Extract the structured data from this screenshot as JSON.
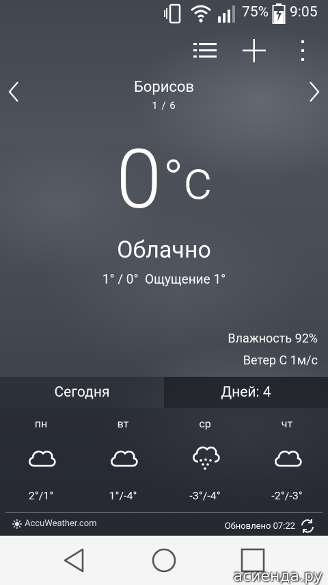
{
  "status_bar": {
    "battery_percent": "75%",
    "time": "9:05",
    "icons": [
      "vibrate-icon",
      "wifi-icon",
      "signal-icon",
      "battery-charging-icon"
    ]
  },
  "toolbar": {
    "icons": [
      "list-icon",
      "add-icon",
      "more-vert-icon"
    ]
  },
  "location": {
    "city": "Борисов",
    "page_indicator": "1 / 6"
  },
  "current": {
    "temperature": "0",
    "unit": "°c",
    "condition": "Облачно",
    "minmax": "1° / 0°",
    "feels_like": "Ощущение 1°",
    "humidity": "Влажность 92%",
    "wind": "Ветер С 1м/с"
  },
  "tabs": {
    "today": "Сегодня",
    "days": "Дней: 4"
  },
  "forecast": [
    {
      "day": "пн",
      "temp": "2°/1°",
      "icon": "cloud-icon"
    },
    {
      "day": "вт",
      "temp": "1°/-4°",
      "icon": "cloud-icon"
    },
    {
      "day": "ср",
      "temp": "-3°/-4°",
      "icon": "snow-cloud-icon"
    },
    {
      "day": "чт",
      "temp": "-2°/-3°",
      "icon": "cloud-icon"
    }
  ],
  "footer": {
    "provider": "AccuWeather.com",
    "updated": "Обновлено 07:22"
  },
  "watermark": "асиенда.ру"
}
